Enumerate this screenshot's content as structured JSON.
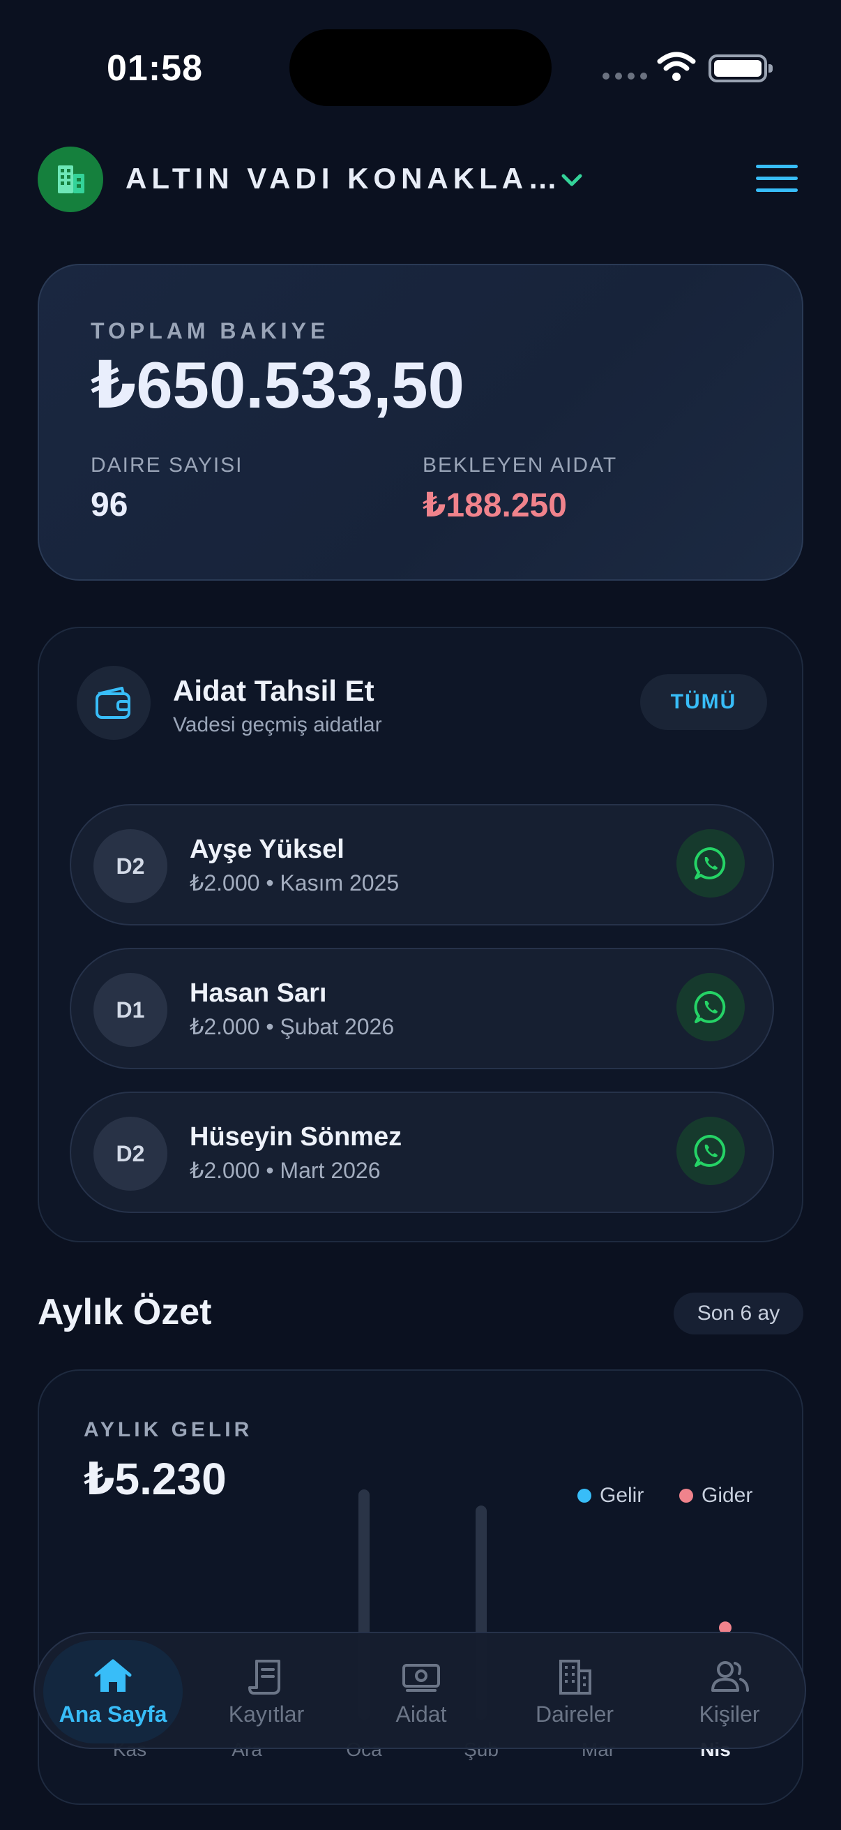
{
  "status_bar": {
    "time": "01:58"
  },
  "header": {
    "title": "ALTIN VADI KONAKLA…",
    "building_icon": "building-icon",
    "chevron_icon": "chevron-down-icon",
    "menu_icon": "hamburger-menu-icon"
  },
  "balance": {
    "label": "TOPLAM BAKIYE",
    "amount": "₺650.533,50",
    "units_label": "DAIRE SAYISI",
    "units_value": "96",
    "pending_label": "BEKLEYEN AIDAT",
    "pending_value": "₺188.250",
    "pending_color": "#f0838c"
  },
  "collect": {
    "title": "Aidat Tahsil Et",
    "subtitle": "Vadesi geçmiş aidatlar",
    "all_label": "TÜMÜ",
    "items": [
      {
        "unit": "D2",
        "name": "Ayşe Yüksel",
        "detail": "₺2.000 • Kasım 2025"
      },
      {
        "unit": "D1",
        "name": "Hasan Sarı",
        "detail": "₺2.000 • Şubat 2026"
      },
      {
        "unit": "D2",
        "name": "Hüseyin Sönmez",
        "detail": "₺2.000 • Mart 2026"
      }
    ]
  },
  "summary": {
    "title": "Aylık Özet",
    "period": "Son 6 ay"
  },
  "chart_data": {
    "type": "bar",
    "title": "AYLIK GELIR",
    "headline_value": "₺5.230",
    "categories": [
      "Kas",
      "Ara",
      "Oca",
      "Şub",
      "Mar",
      "Nis"
    ],
    "series": [
      {
        "name": "Gelir",
        "color": "#38bdf8"
      },
      {
        "name": "Gider",
        "color": "#f0838c"
      }
    ],
    "bar_values": [
      0,
      0,
      1.0,
      0.93,
      0,
      0.06
    ]
  },
  "nav": {
    "items": [
      {
        "label": "Ana Sayfa",
        "icon": "home-icon",
        "active": true
      },
      {
        "label": "Kayıtlar",
        "icon": "receipt-icon",
        "active": false
      },
      {
        "label": "Aidat",
        "icon": "banknote-icon",
        "active": false
      },
      {
        "label": "Daireler",
        "icon": "building-icon",
        "active": false
      },
      {
        "label": "Kişiler",
        "icon": "users-icon",
        "active": false
      }
    ]
  }
}
